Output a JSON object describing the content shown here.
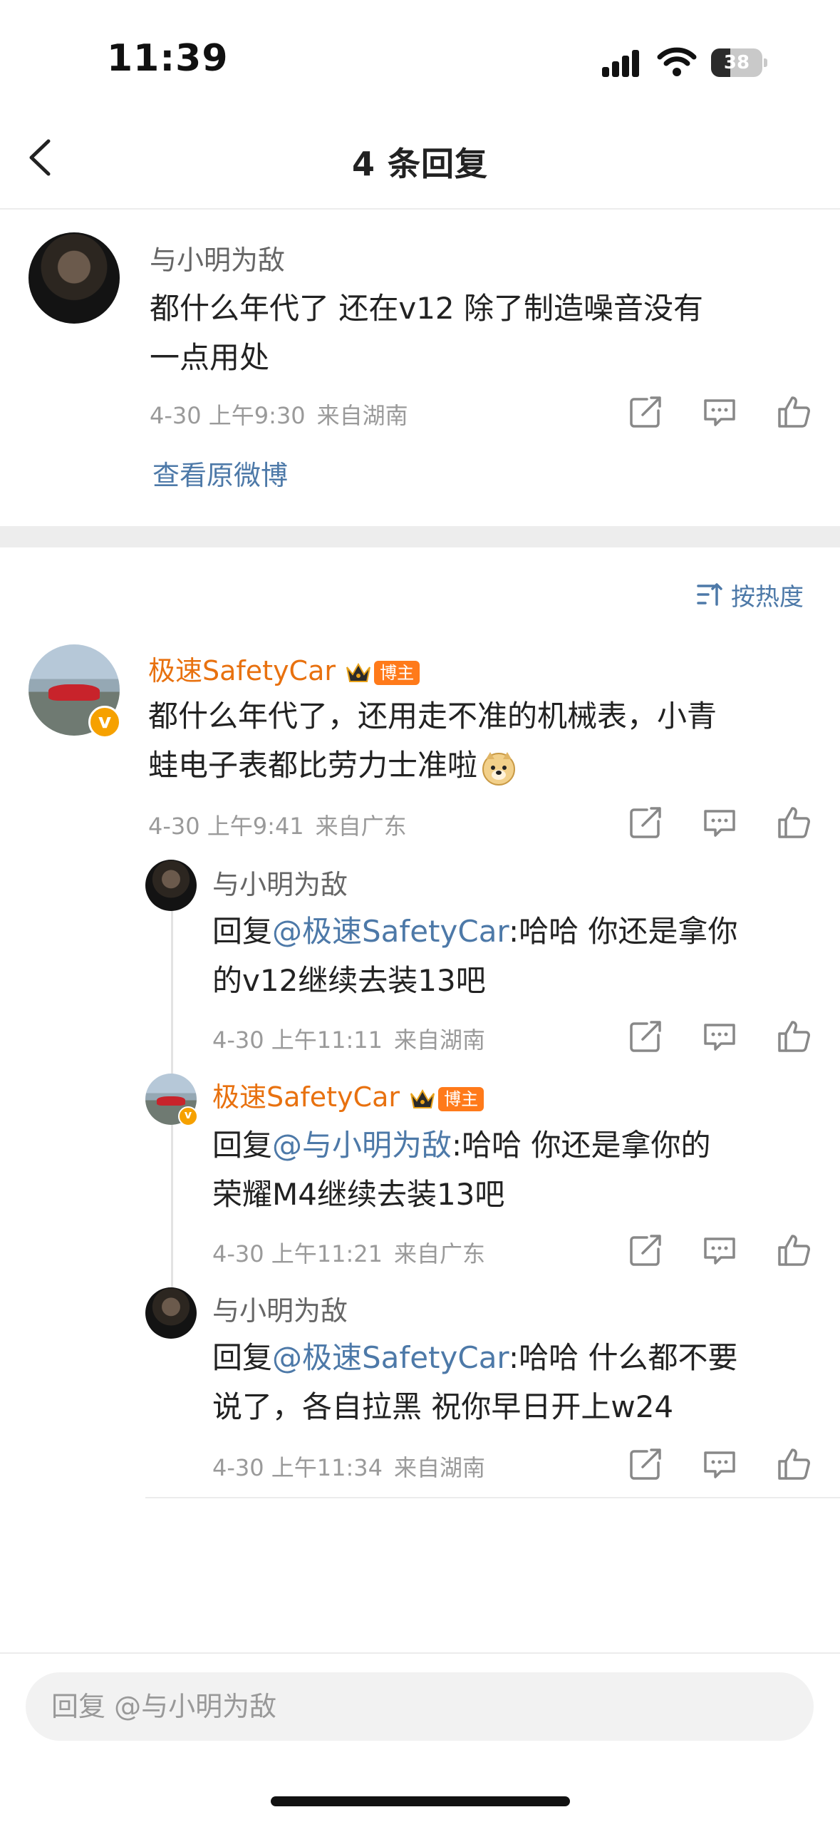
{
  "status_bar": {
    "time": "11:39",
    "battery": "38",
    "battery_level": 0.38
  },
  "nav": {
    "title": "4 条回复"
  },
  "main_comment": {
    "user": "与小明为敌",
    "line1": "都什么年代了 还在v12  除了制造噪音没有",
    "line2": "一点用处",
    "date": "4-30 上午9:30",
    "location": "来自湖南",
    "view_original": "查看原微博"
  },
  "sort": {
    "label": "按热度"
  },
  "top_reply": {
    "user": "极速SafetyCar",
    "badge": "博主",
    "line1": "都什么年代了，还用走不准的机械表，小青",
    "line2": "蛙电子表都比劳力士准啦",
    "date": "4-30 上午9:41",
    "location": "来自广东"
  },
  "replies": [
    {
      "user": "与小明为敌",
      "reply_prefix": "回复",
      "mention": "@极速SafetyCar",
      "line1_rest": ":哈哈  你还是拿你",
      "line2": "的v12继续去装13吧",
      "date": "4-30 上午11:11",
      "location": "来自湖南"
    },
    {
      "user": "极速SafetyCar",
      "badge": "博主",
      "reply_prefix": "回复",
      "mention": "@与小明为敌",
      "line1_rest": ":哈哈  你还是拿你的",
      "line2": "荣耀M4继续去装13吧",
      "date": "4-30 上午11:21",
      "location": "来自广东"
    },
    {
      "user": "与小明为敌",
      "reply_prefix": "回复",
      "mention": "@极速SafetyCar",
      "line1_rest": ":哈哈 什么都不要",
      "line2": "说了，各自拉黑  祝你早日开上w24",
      "date": "4-30 上午11:34",
      "location": "来自湖南"
    }
  ],
  "reply_bar": {
    "placeholder": "回复 @与小明为敌"
  },
  "icons": {
    "share": "share-icon",
    "comment": "comment-icon",
    "like": "like-icon",
    "back": "chevron-left-icon",
    "sort": "sort-icon",
    "crown": "crown-icon",
    "verified": "verified-v-icon"
  },
  "colors": {
    "link": "#4d79a8",
    "vip_name": "#e8710f",
    "badge": "#ff7a1a",
    "verified": "#f6a100"
  }
}
